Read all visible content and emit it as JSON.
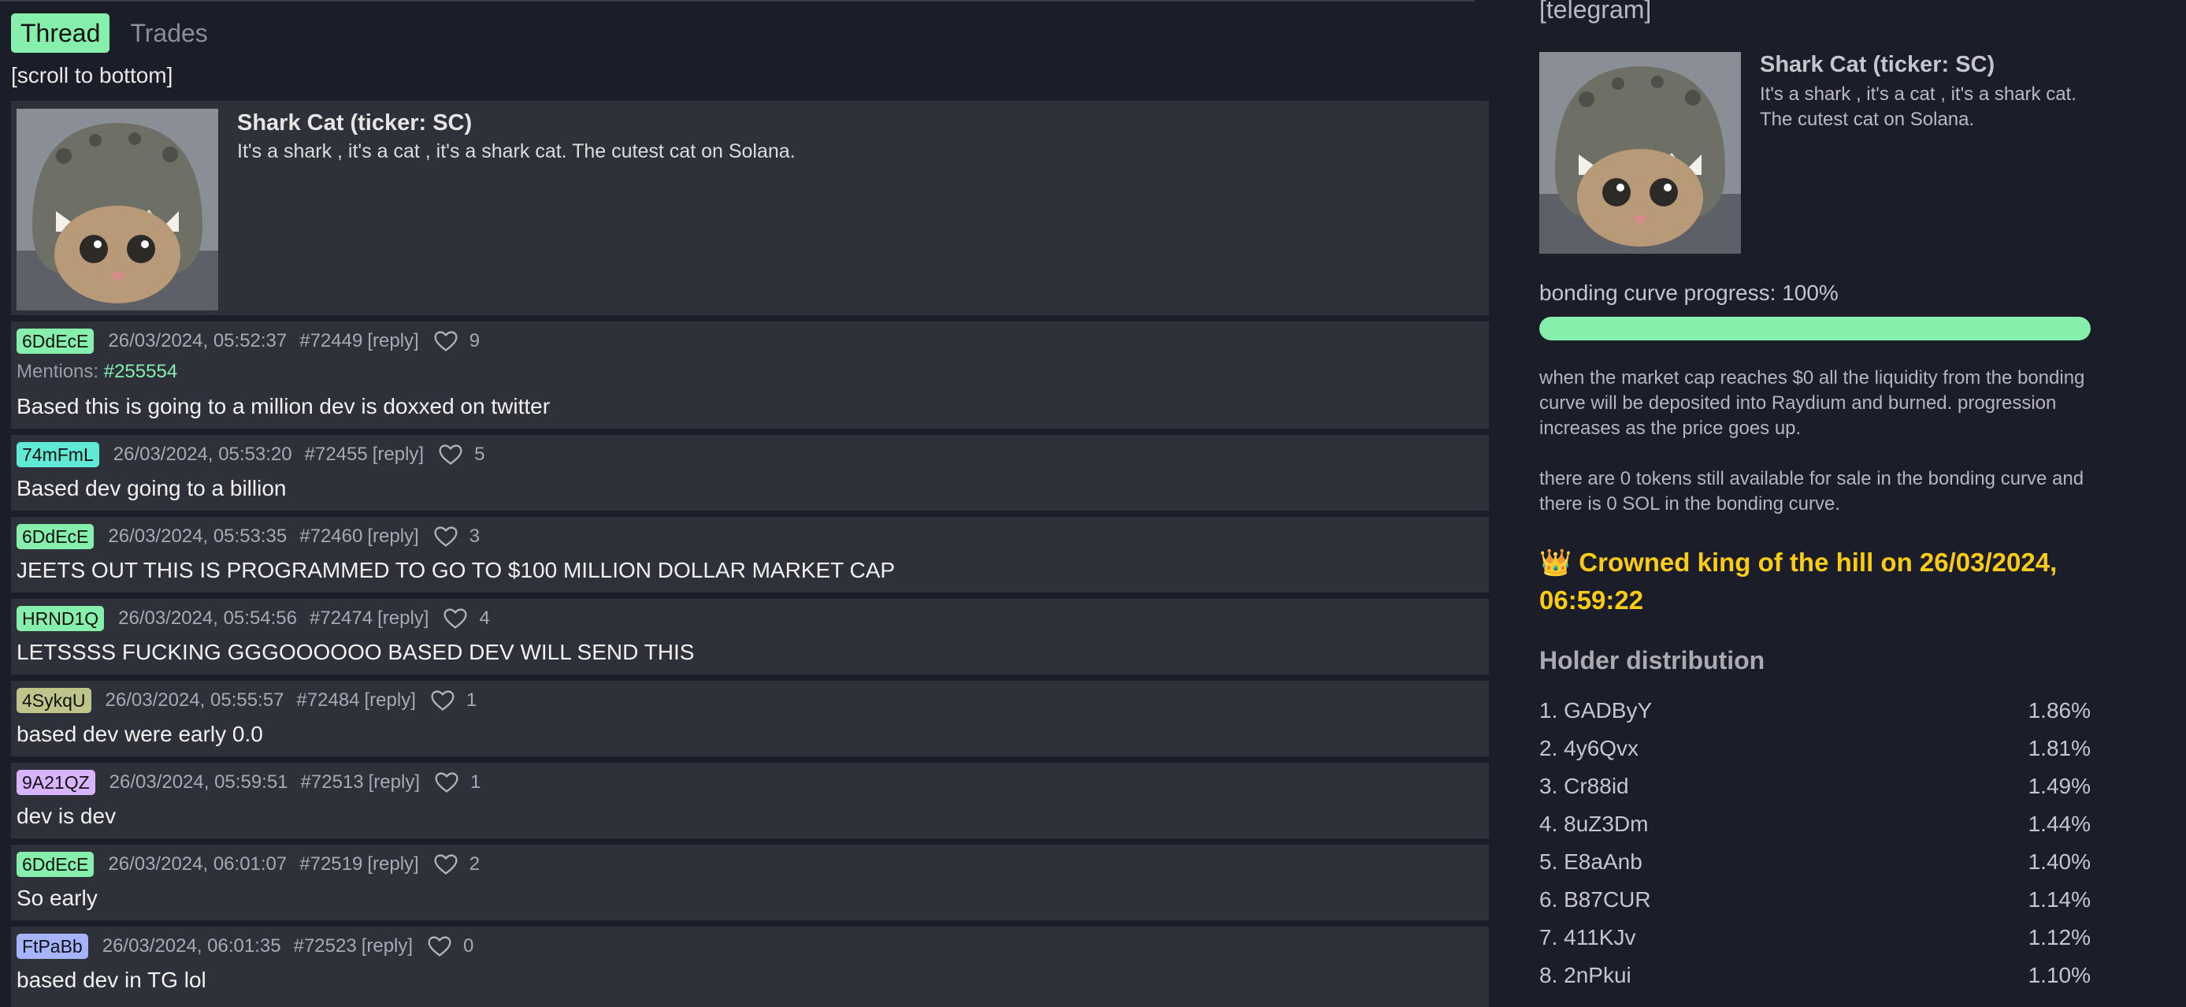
{
  "tabs": [
    {
      "label": "Thread",
      "active": true
    },
    {
      "label": "Trades",
      "active": false
    }
  ],
  "scroll_link": "[scroll to bottom]",
  "token": {
    "title": "Shark Cat (ticker: SC)",
    "description": "It's a shark , it's a cat , it's a shark cat. The cutest cat on Solana.",
    "image": "shark-cat-image"
  },
  "posts": [
    {
      "user": "6DdEcE",
      "badge_color": "#86efac",
      "date": "26/03/2024, 05:52:37",
      "id": "#72449",
      "reply": "[reply]",
      "likes": "9",
      "mentions_label": "Mentions:",
      "mentions_ref": "#255554",
      "text": "Based this is going to a million dev is doxxed on twitter"
    },
    {
      "user": "74mFmL",
      "badge_color": "#5eead4",
      "date": "26/03/2024, 05:53:20",
      "id": "#72455",
      "reply": "[reply]",
      "likes": "5",
      "text": "Based dev going to a billion"
    },
    {
      "user": "6DdEcE",
      "badge_color": "#86efac",
      "date": "26/03/2024, 05:53:35",
      "id": "#72460",
      "reply": "[reply]",
      "likes": "3",
      "text": "JEETS OUT THIS IS PROGRAMMED TO GO TO $100 MILLION DOLLAR MARKET CAP"
    },
    {
      "user": "HRND1Q",
      "badge_color": "#86efac",
      "date": "26/03/2024, 05:54:56",
      "id": "#72474",
      "reply": "[reply]",
      "likes": "4",
      "text": "LETSSSS FUCKING GGGOOOOOO BASED DEV WILL SEND THIS"
    },
    {
      "user": "4SykqU",
      "badge_color": "#bfc48a",
      "date": "26/03/2024, 05:55:57",
      "id": "#72484",
      "reply": "[reply]",
      "likes": "1",
      "text": "based dev were early 0.0"
    },
    {
      "user": "9A21QZ",
      "badge_color": "#d8b4fe",
      "date": "26/03/2024, 05:59:51",
      "id": "#72513",
      "reply": "[reply]",
      "likes": "1",
      "text": "dev is dev"
    },
    {
      "user": "6DdEcE",
      "badge_color": "#86efac",
      "date": "26/03/2024, 06:01:07",
      "id": "#72519",
      "reply": "[reply]",
      "likes": "2",
      "text": "So early"
    },
    {
      "user": "FtPaBb",
      "badge_color": "#a5b4fc",
      "date": "26/03/2024, 06:01:35",
      "id": "#72523",
      "reply": "[reply]",
      "likes": "0",
      "text": "based dev in TG lol"
    }
  ],
  "sidebar": {
    "telegram_link": "[telegram]",
    "title": "Shark Cat (ticker: SC)",
    "description": "It's a shark , it's a cat , it's a shark cat. The cutest cat on Solana.",
    "progress_label": "bonding curve progress: 100%",
    "progress_value": 1.0,
    "info_1": "when the market cap reaches $0 all the liquidity from the bonding curve will be deposited into Raydium and burned. progression increases as the price goes up.",
    "info_2": "there are 0 tokens still available for sale in the bonding curve and there is 0 SOL in the bonding curve.",
    "crown_icon": "👑",
    "crown_text": "Crowned king of the hill on 26/03/2024, 06:59:22",
    "holder_title": "Holder distribution",
    "holders": [
      {
        "rank": "1. GADByY",
        "pct": "1.86%"
      },
      {
        "rank": "2. 4y6Qvx",
        "pct": "1.81%"
      },
      {
        "rank": "3. Cr88id",
        "pct": "1.49%"
      },
      {
        "rank": "4. 8uZ3Dm",
        "pct": "1.44%"
      },
      {
        "rank": "5. E8aAnb",
        "pct": "1.40%"
      },
      {
        "rank": "6. B87CUR",
        "pct": "1.14%"
      },
      {
        "rank": "7. 411KJv",
        "pct": "1.12%"
      },
      {
        "rank": "8. 2nPkui",
        "pct": "1.10%"
      }
    ]
  }
}
